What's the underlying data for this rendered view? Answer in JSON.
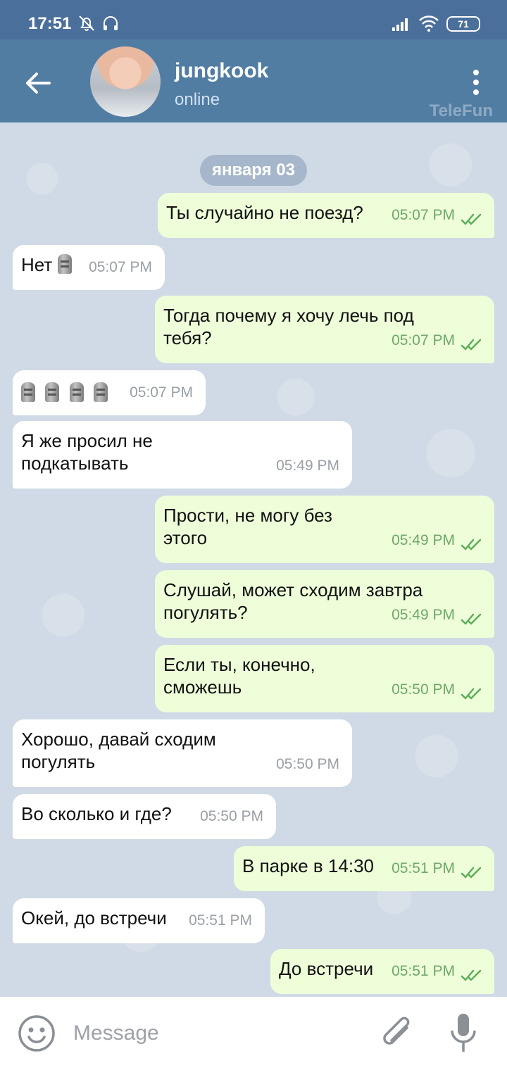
{
  "status_bar": {
    "time": "17:51",
    "battery": "71"
  },
  "header": {
    "contact_name": "jungkook",
    "contact_status": "online",
    "watermark": "TeleFun"
  },
  "chat": {
    "date_label": "января 03",
    "messages": [
      {
        "dir": "out",
        "text": "Ты случайно не поезд?",
        "time": "05:07 PM",
        "read": true
      },
      {
        "dir": "in",
        "text": "Нет",
        "emoji": "moai",
        "time": "05:07 PM"
      },
      {
        "dir": "out",
        "text": "Тогда почему я хочу лечь под\nтебя?",
        "time": "05:07 PM",
        "read": true
      },
      {
        "dir": "in",
        "emoji": "moai x4",
        "time": "05:07 PM"
      },
      {
        "dir": "in",
        "text": "Я же просил не\nподкатывать",
        "time": "05:49 PM"
      },
      {
        "dir": "out",
        "text": "Прости, не могу без\nэтого",
        "time": "05:49 PM",
        "read": true
      },
      {
        "dir": "out",
        "text": "Слушай, может сходим завтра\nпогулять?",
        "time": "05:49 PM",
        "read": true
      },
      {
        "dir": "out",
        "text": "Если ты, конечно,\nсможешь",
        "time": "05:50 PM",
        "read": true
      },
      {
        "dir": "in",
        "text": "Хорошо, давай сходим\nпогулять",
        "time": "05:50 PM"
      },
      {
        "dir": "in",
        "text": "Во сколько и где?",
        "time": "05:50 PM"
      },
      {
        "dir": "out",
        "text": "В парке в 14:30",
        "time": "05:51 PM",
        "read": true
      },
      {
        "dir": "in",
        "text": "Окей, до встречи",
        "time": "05:51 PM"
      },
      {
        "dir": "out",
        "text": "До встречи",
        "time": "05:51 PM",
        "read": true
      }
    ]
  },
  "composer": {
    "placeholder": "Message"
  },
  "icons": {
    "back": "arrow-left-icon",
    "menu": "more-vertical-icon",
    "emoji": "smiley-icon",
    "attach": "paperclip-icon",
    "mic": "microphone-icon",
    "read": "double-check-icon"
  },
  "colors": {
    "header": "#527da3",
    "statusbar": "#4a6f9a",
    "outgoing_bubble": "#eefed9",
    "incoming_bubble": "#ffffff",
    "check": "#5cae5a"
  }
}
